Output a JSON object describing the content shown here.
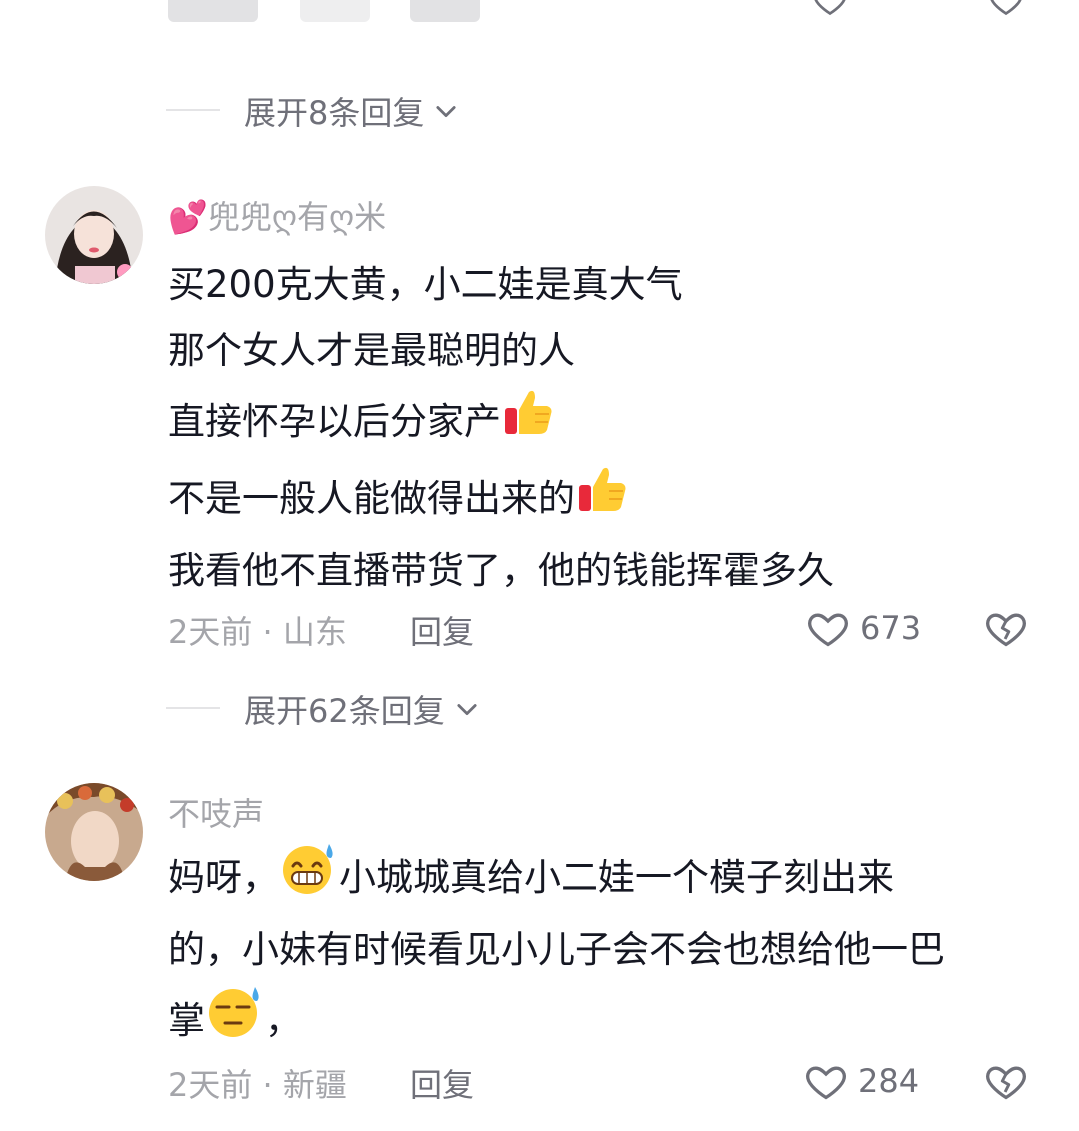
{
  "expand_top": {
    "label": "展开8条回复"
  },
  "comments": [
    {
      "username": "💕兜兜ღ有ღ米",
      "lines": [
        "买200克大黄，小二娃是真大气",
        "那个女人才是最聪明的人",
        "直接怀孕以后分家产",
        "不是一般人能做得出来的",
        "我看他不直播带货了，他的钱能挥霍多久"
      ],
      "time": "2天前",
      "location": "山东",
      "reply_label": "回复",
      "likes": "673",
      "expand_label": "展开62条回复"
    },
    {
      "username": "不吱声",
      "line1_a": "妈呀，",
      "line1_b": "小城城真给小二娃一个模子刻出来",
      "line2": "的，小妹有时候看见小儿子会不会也想给他一巴",
      "line3_a": "掌",
      "line3_b": "，",
      "time": "2天前",
      "location": "新疆",
      "reply_label": "回复",
      "likes": "284"
    }
  ],
  "icons": [
    "heart-icon",
    "broken-heart-icon",
    "chevron-down-icon",
    "thumbs-up-emoji",
    "grin-sweat-emoji",
    "sweat-emoji"
  ],
  "colors": {
    "text": "#161823",
    "muted": "#a4a5aa",
    "secondary": "#6f7079"
  }
}
